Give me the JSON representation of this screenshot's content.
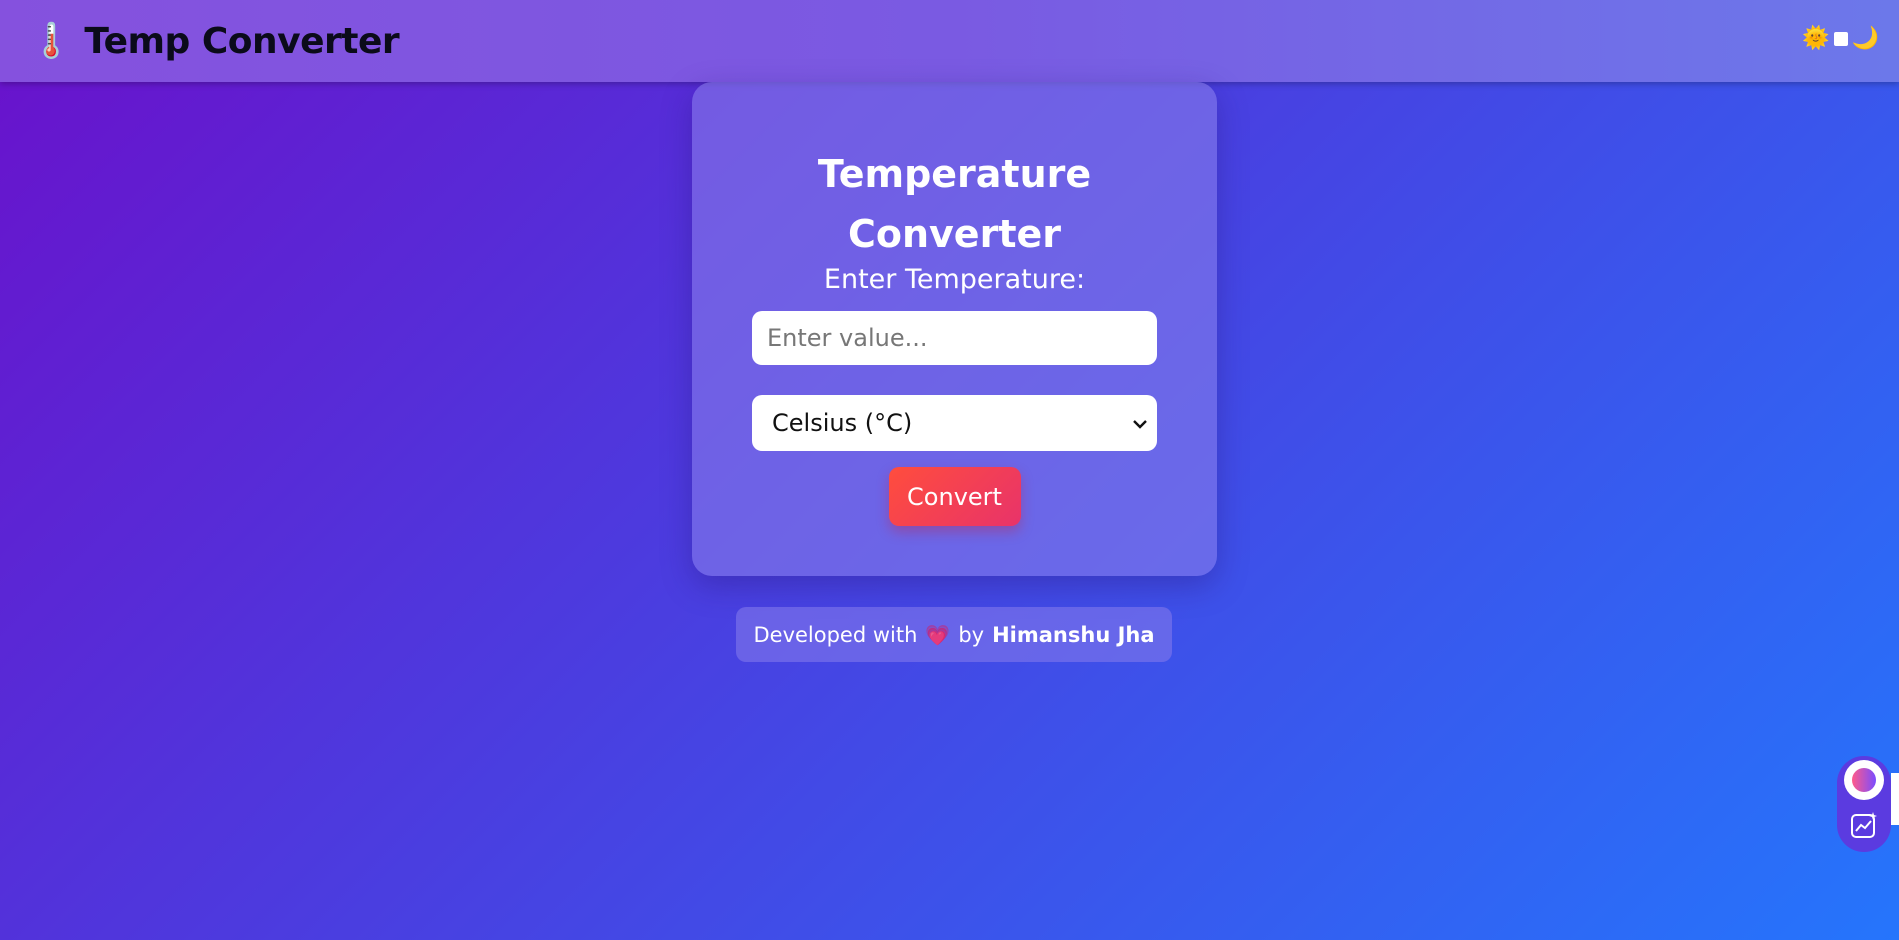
{
  "navbar": {
    "brand_icon": "🌡️",
    "brand_title": "Temp Converter",
    "theme_toggle": {
      "sun": "🌞",
      "moon": "🌙"
    }
  },
  "card": {
    "title": "Temperature Converter",
    "input_label": "Enter Temperature:",
    "input_placeholder": "Enter value...",
    "input_value": "",
    "unit_selected": "Celsius (°C)",
    "convert_label": "Convert"
  },
  "footer": {
    "prefix": "Developed with",
    "heart": "💗",
    "by": "by",
    "author": "Himanshu Jha"
  },
  "colors": {
    "background_start": "#6a11cb",
    "background_end": "#2575fc",
    "convert_start": "#ff4d3d",
    "convert_end": "#e8336a"
  },
  "icons": [
    "thermometer-icon",
    "sun-icon",
    "moon-icon",
    "chevron-down-icon",
    "heart-icon",
    "assistant-orb-icon",
    "chart-sparkle-icon"
  ]
}
